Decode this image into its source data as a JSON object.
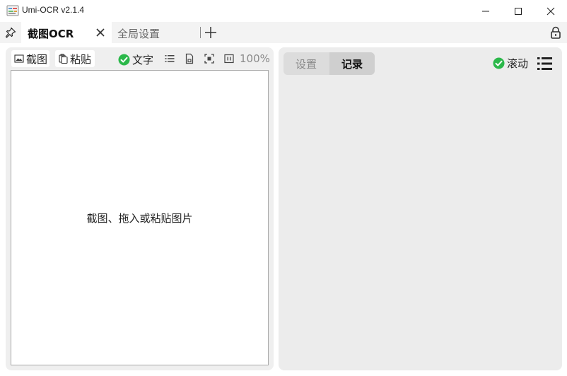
{
  "window": {
    "title": "Umi-OCR v2.1.4"
  },
  "tabs": {
    "active_label": "截图OCR",
    "inactive_label": "全局设置"
  },
  "left_panel": {
    "screenshot_label": "截图",
    "paste_label": "粘贴",
    "text_toggle_label": "文字",
    "text_toggle_checked": true,
    "zoom": "100%",
    "image_hint": "截图、拖入或粘贴图片"
  },
  "right_panel": {
    "tabs": [
      {
        "label": "设置",
        "active": false
      },
      {
        "label": "记录",
        "active": true
      }
    ],
    "scroll_label": "滚动",
    "scroll_checked": true
  },
  "colors": {
    "check_green": "#2bb84a",
    "panel_bg": "#efefef"
  },
  "icons": {
    "pin": "pin-icon",
    "close": "close-icon",
    "add": "plus-icon",
    "lock": "lock-icon",
    "screenshot": "image-icon",
    "paste": "clipboard-icon",
    "list": "list-icon",
    "save": "file-icon",
    "fit": "fit-screen-icon",
    "ratio": "actual-size-icon",
    "menu": "menu-icon"
  }
}
